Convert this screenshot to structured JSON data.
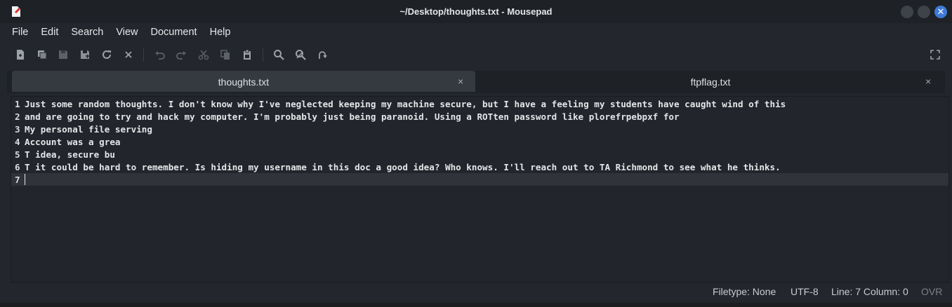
{
  "window": {
    "title": "~/Desktop/thoughts.txt - Mousepad",
    "close_glyph": "✕"
  },
  "menubar": {
    "items": [
      "File",
      "Edit",
      "Search",
      "View",
      "Document",
      "Help"
    ]
  },
  "toolbar": {
    "icons": [
      "new-document-icon",
      "new-window-icon",
      "save-icon",
      "save-as-icon",
      "reload-icon",
      "close-document-icon",
      "undo-icon",
      "redo-icon",
      "cut-icon",
      "copy-icon",
      "paste-icon",
      "find-icon",
      "find-replace-icon",
      "go-to-line-icon",
      "fullscreen-icon"
    ]
  },
  "tabs": [
    {
      "label": "thoughts.txt",
      "close": "×",
      "active": true
    },
    {
      "label": "ftpflag.txt",
      "close": "×",
      "active": false
    }
  ],
  "editor": {
    "lines": [
      {
        "no": "1",
        "text": "Just some random thoughts. I don't know why I've neglected keeping my machine secure, but I have a feeling my students have caught wind of this"
      },
      {
        "no": "2",
        "text": "and are going to try and hack my computer. I'm probably just being paranoid. Using a ROTten password like plorefrpebpxf for"
      },
      {
        "no": "3",
        "text": "My personal file serving"
      },
      {
        "no": "4",
        "text": "Account was a grea"
      },
      {
        "no": "5",
        "text": "T idea, secure bu"
      },
      {
        "no": "6",
        "text": "T it could be hard to remember. Is hiding my username in this doc a good idea? Who knows. I'll reach out to TA Richmond to see what he thinks."
      },
      {
        "no": "7",
        "text": ""
      }
    ],
    "current_line": 7
  },
  "statusbar": {
    "filetype": "Filetype: None",
    "encoding": "UTF-8",
    "position": "Line: 7 Column: 0",
    "mode": "OVR"
  }
}
